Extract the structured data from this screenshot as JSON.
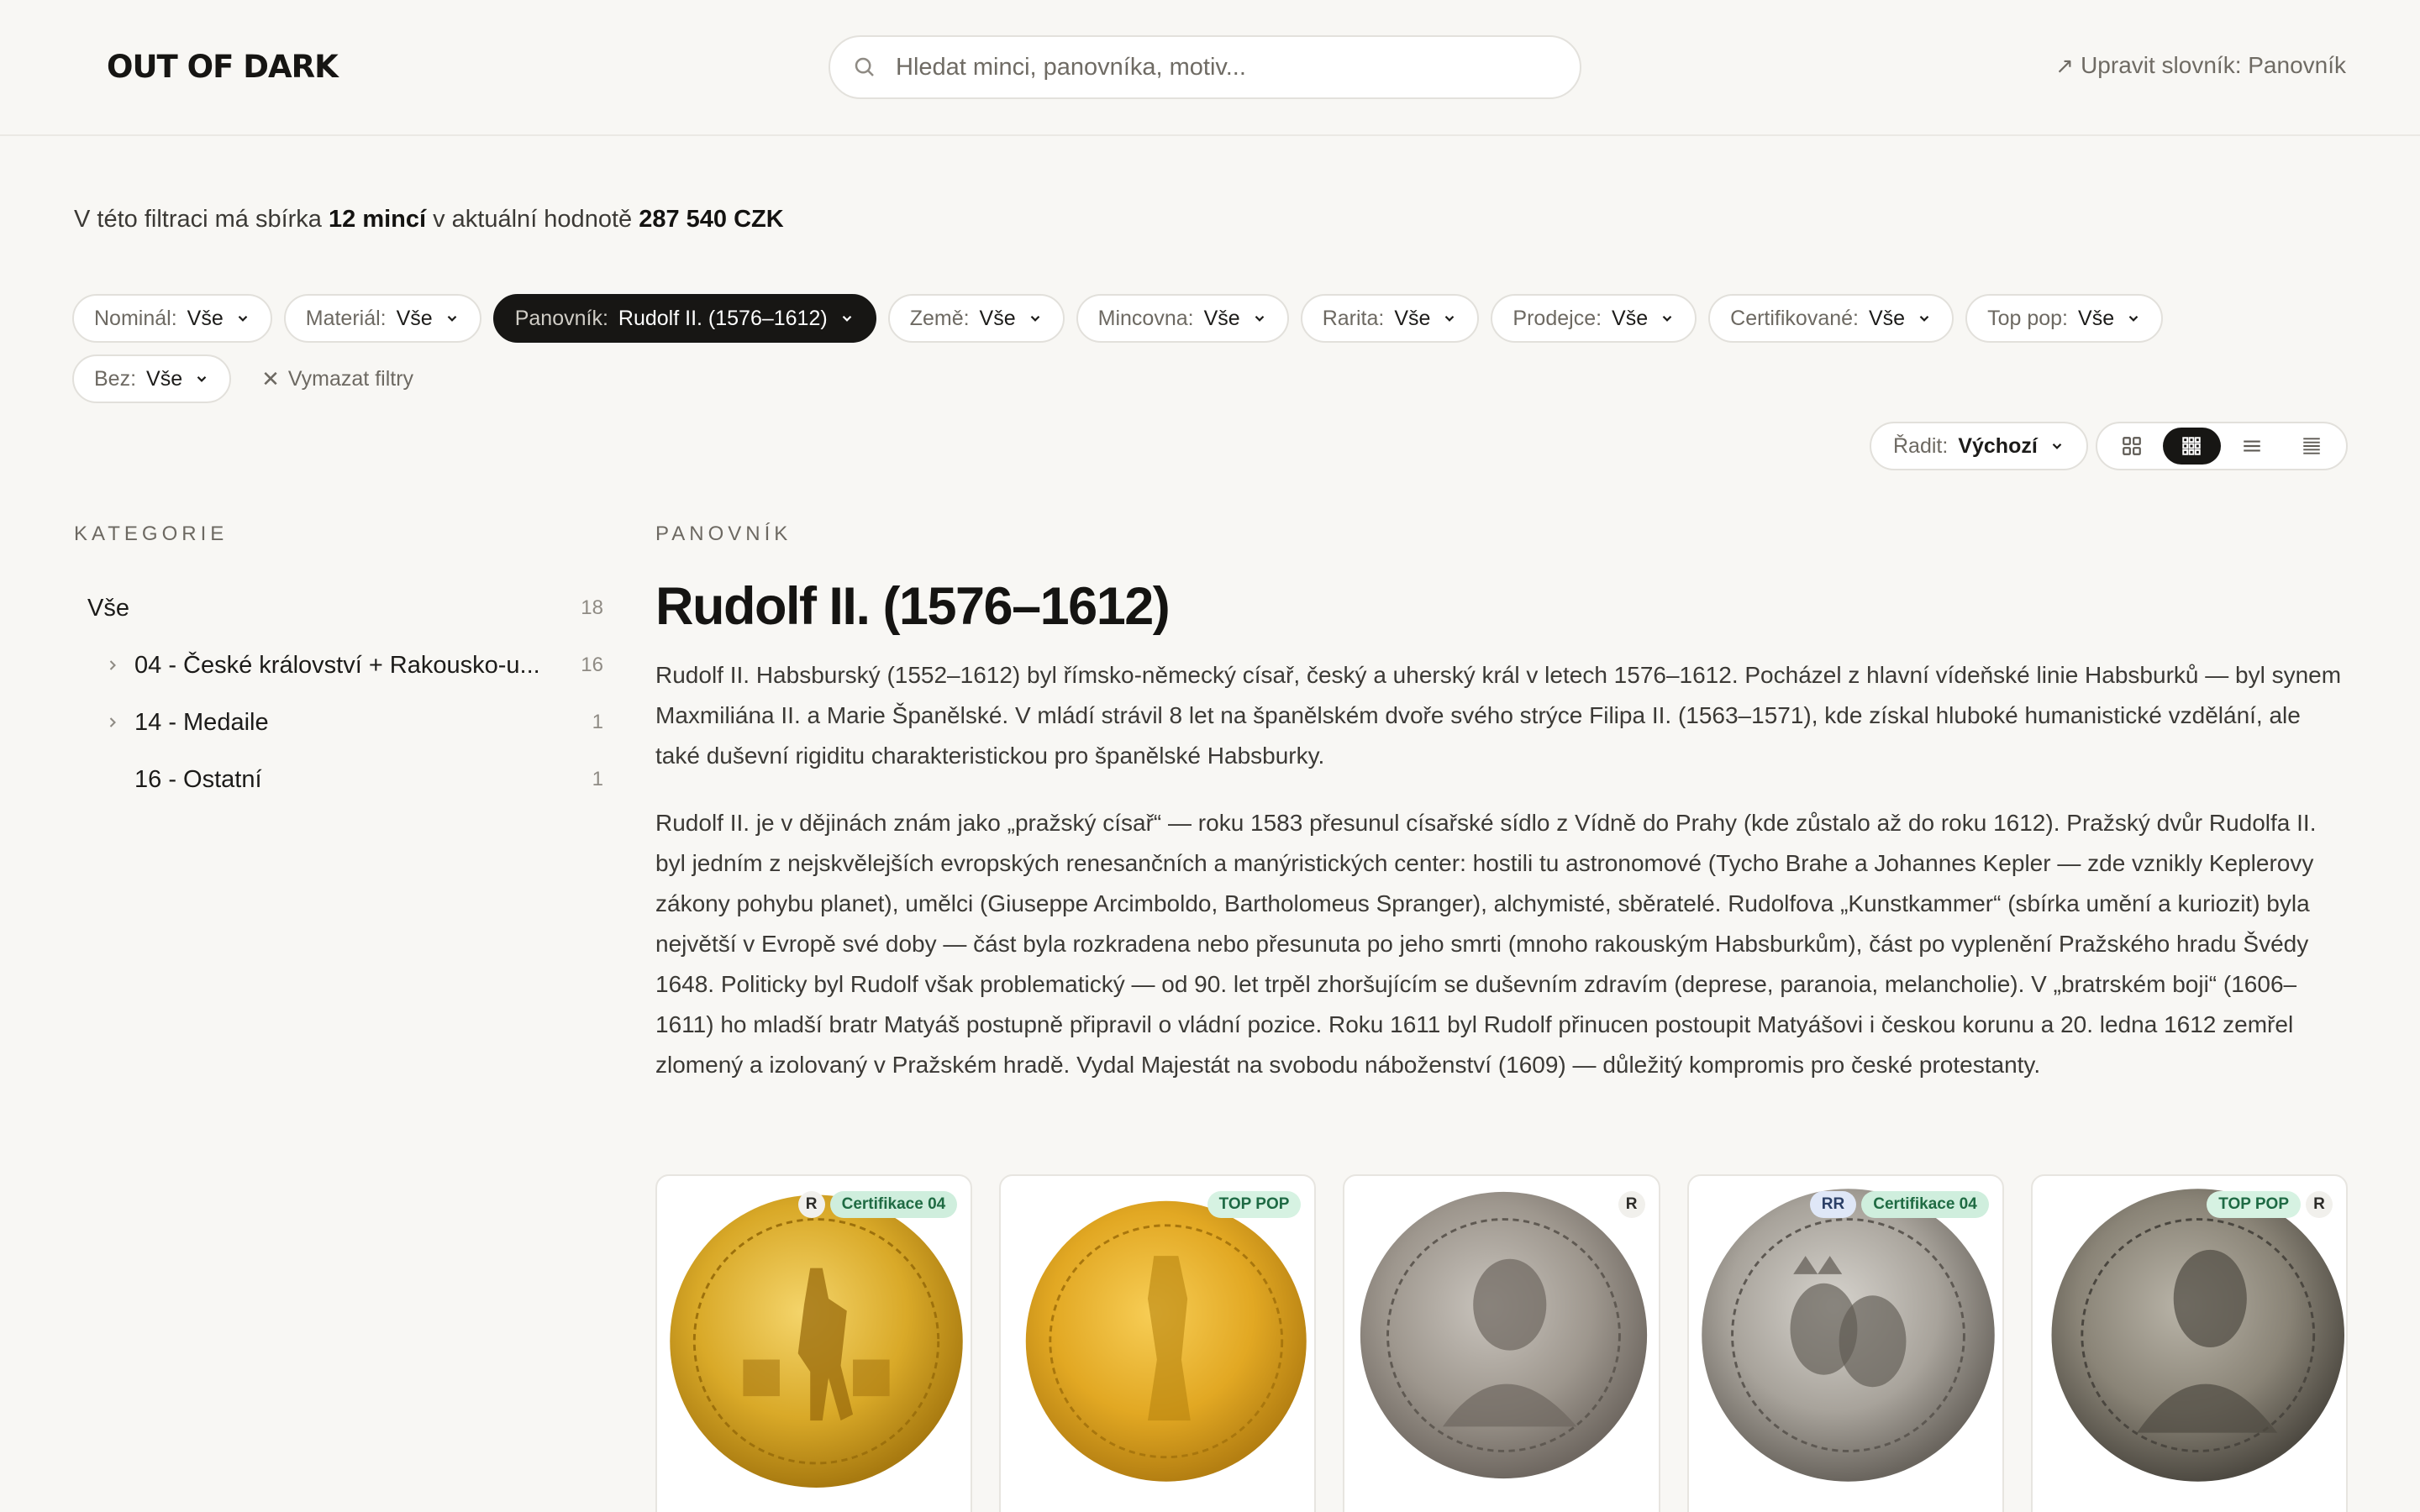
{
  "header": {
    "logo": "OUT OF DARK",
    "search_placeholder": "Hledat minci, panovníka, motiv...",
    "edit_link": "Upravit slovník: Panovník"
  },
  "summary": {
    "prefix": "V této filtraci má sbírka ",
    "count": "12 mincí",
    "middle": " v aktuální hodnotě ",
    "value": "287 540 CZK"
  },
  "filters": [
    {
      "label": "Nominál:",
      "value": "Vše",
      "active": false
    },
    {
      "label": "Materiál:",
      "value": "Vše",
      "active": false
    },
    {
      "label": "Panovník:",
      "value": "Rudolf II. (1576–1612)",
      "active": true
    },
    {
      "label": "Země:",
      "value": "Vše",
      "active": false
    },
    {
      "label": "Mincovna:",
      "value": "Vše",
      "active": false
    },
    {
      "label": "Rarita:",
      "value": "Vše",
      "active": false
    },
    {
      "label": "Prodejce:",
      "value": "Vše",
      "active": false
    },
    {
      "label": "Certifikované:",
      "value": "Vše",
      "active": false
    },
    {
      "label": "Top pop:",
      "value": "Vše",
      "active": false
    },
    {
      "label": "Bez:",
      "value": "Vše",
      "active": false
    }
  ],
  "clear_filters": "Vymazat filtry",
  "sort": {
    "label": "Řadit:",
    "value": "Výchozí"
  },
  "view_modes": [
    "grid-large-icon",
    "grid-small-icon",
    "list-icon",
    "dense-list-icon"
  ],
  "sidebar": {
    "title": "KATEGORIE",
    "items": [
      {
        "label": "Vše",
        "count": "18"
      },
      {
        "label": "04 - České království + Rakousko-u...",
        "count": "16"
      },
      {
        "label": "14 - Medaile",
        "count": "1"
      },
      {
        "label": "16 - Ostatní",
        "count": "1"
      }
    ]
  },
  "main": {
    "kicker": "PANOVNÍK",
    "title": "Rudolf II. (1576–1612)",
    "paragraphs": [
      "Rudolf II. Habsburský (1552–1612) byl římsko-německý císař, český a uherský král v letech 1576–1612. Pocházel z hlavní vídeňské linie Habsburků — byl synem Maxmiliána II. a Marie Španělské. V mládí strávil 8 let na španělském dvoře svého strýce Filipa II. (1563–1571), kde získal hluboké humanistické vzdělání, ale také duševní rigiditu charakteristickou pro španělské Habsburky.",
      "Rudolf II. je v dějinách znám jako „pražský císař“ — roku 1583 přesunul císařské sídlo z Vídně do Prahy (kde zůstalo až do roku 1612). Pražský dvůr Rudolfa II. byl jedním z nejskvělejších evropských renesančních a manýristických center: hostili tu astronomové (Tycho Brahe a Johannes Kepler — zde vznikly Keplerovy zákony pohybu planet), umělci (Giuseppe Arcimboldo, Bartholomeus Spranger), alchymisté, sběratelé. Rudolfova „Kunstkammer“ (sbírka umění a kuriozit) byla největší v Evropě své doby — část byla rozkradena nebo přesunuta po jeho smrti (mnoho rakouským Habsburkům), část po vyplenění Pražského hradu Švédy 1648. Politicky byl Rudolf však problematický — od 90. let trpěl zhoršujícím se duševním zdravím (deprese, paranoia, melancholie). V „bratrském boji“ (1606–1611) ho mladší bratr Matyáš postupně připravil o vládní pozice. Roku 1611 byl Rudolf přinucen postoupit Matyášovi i českou korunu a 20. ledna 1612 zemřel zlomený a izolovaný v Pražském hradě. Vydal Majestát na svobodu náboženství (1609) — důležitý kompromis pro české protestanty."
    ]
  },
  "cards": [
    {
      "badges": [
        {
          "text": "R",
          "type": "r"
        },
        {
          "text": "Certifikace 04",
          "type": "cert"
        }
      ],
      "coin": "gold-ducat-standing-icon"
    },
    {
      "badges": [
        {
          "text": "TOP POP",
          "type": "top"
        }
      ],
      "coin": "gold-ducat-icon"
    },
    {
      "badges": [
        {
          "text": "R",
          "type": "r"
        }
      ],
      "coin": "silver-thaler-portrait-icon"
    },
    {
      "badges": [
        {
          "text": "RR",
          "type": "rr"
        },
        {
          "text": "Certifikace 04",
          "type": "cert"
        }
      ],
      "coin": "silver-double-portrait-icon"
    },
    {
      "badges": [
        {
          "text": "TOP POP",
          "type": "top"
        },
        {
          "text": "R",
          "type": "r"
        }
      ],
      "coin": "silver-thaler-dark-icon"
    }
  ],
  "colors": {
    "background": "#f8f7f4",
    "active_chip": "#171614",
    "badge_green": "#cfeedd",
    "badge_blue": "#dfe7f7"
  }
}
